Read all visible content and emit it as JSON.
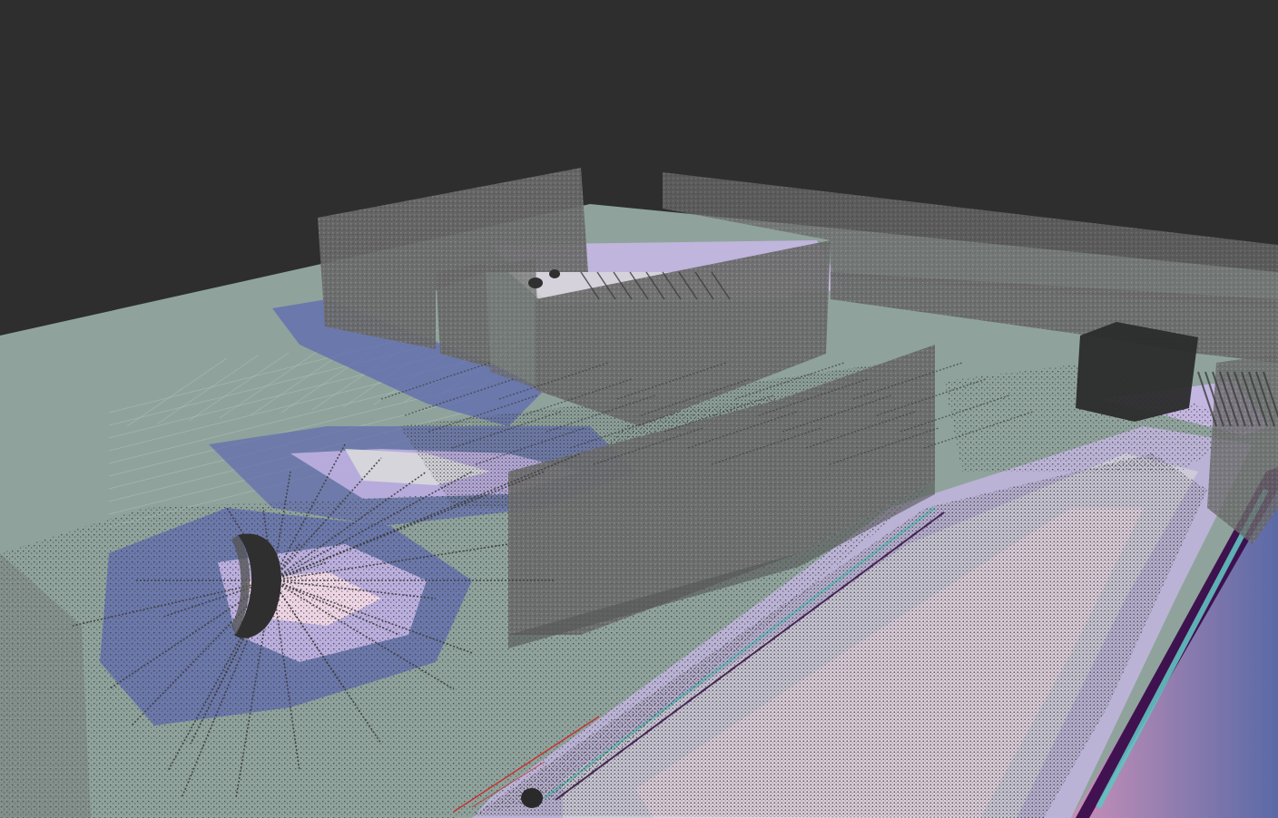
{
  "viewer": {
    "background_color": "#2e2e2e",
    "ground_plane_color": "#8fa39c",
    "grid_color": "#b6c6c0",
    "point_cloud_color": "#7a7a7a",
    "laser_scan_color": "#3c3c3c",
    "costmap_colors": {
      "free": "#dcdcdc",
      "inflation_low": "#5f6ab0",
      "inflation_mid": "#c9b8e8",
      "inflation_high": "#f4d9e6",
      "lethal": "#3a0c4a",
      "edge": "#62c2c0"
    },
    "path_color": "#d21e1e",
    "icons": [
      "robot-marker-icon"
    ]
  }
}
